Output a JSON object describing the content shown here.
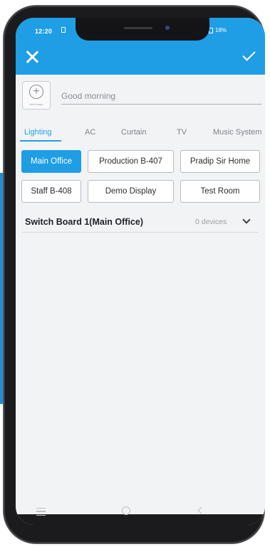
{
  "status_bar": {
    "time": "12:20",
    "battery": "18%"
  },
  "header": {
    "close_icon": "close-icon",
    "confirm_icon": "check-icon",
    "color": "#1f9ee6"
  },
  "scene": {
    "add_image_caption": "Add image",
    "name_placeholder": "Good morning"
  },
  "tabs": [
    {
      "label": "Lighting",
      "active": true
    },
    {
      "label": "AC"
    },
    {
      "label": "Curtain"
    },
    {
      "label": "TV"
    },
    {
      "label": "Music System"
    }
  ],
  "rooms": [
    {
      "label": "Main Office",
      "active": true
    },
    {
      "label": "Production B-407"
    },
    {
      "label": "Pradip Sir Home"
    },
    {
      "label": "Staff B-408"
    },
    {
      "label": "Demo Display"
    },
    {
      "label": "Test Room"
    }
  ],
  "switch_board": {
    "name": "Switch Board 1(Main Office)",
    "count": "0 devices"
  }
}
